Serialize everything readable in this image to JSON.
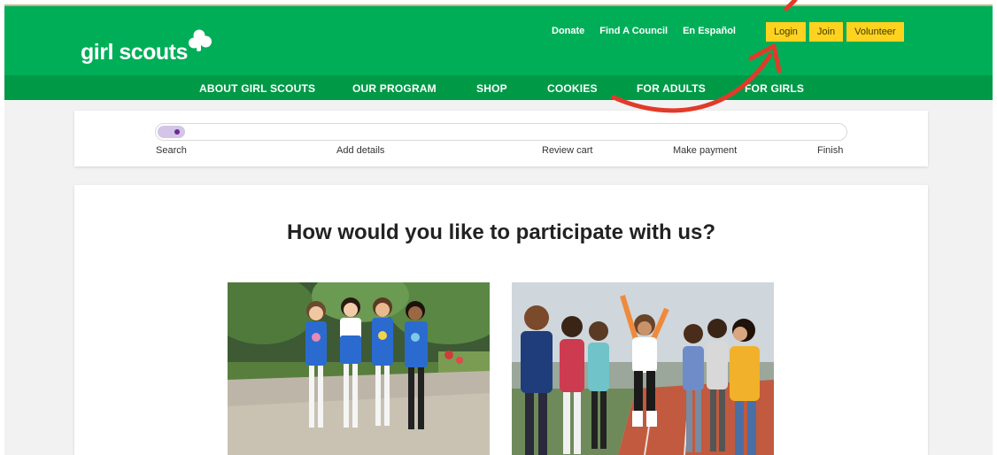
{
  "header": {
    "logo_text": "girl scouts",
    "util_links": [
      "Donate",
      "Find A Council",
      "En Español"
    ],
    "auth_buttons": [
      "Login",
      "Join",
      "Volunteer"
    ]
  },
  "nav": {
    "items": [
      "ABOUT GIRL SCOUTS",
      "OUR PROGRAM",
      "SHOP",
      "COOKIES",
      "FOR ADULTS",
      "FOR GIRLS"
    ]
  },
  "progress": {
    "fraction": 0.04,
    "steps": [
      "Search",
      "Add details",
      "Review cart",
      "Make payment",
      "Finish"
    ]
  },
  "main": {
    "title": "How would you like to participate with us?"
  },
  "colors": {
    "brand_green": "#00ae58",
    "nav_green": "#009a47",
    "button_yellow": "#ffd21f",
    "progress_purple": "#6a2c91",
    "annotation_red": "#e23a2a"
  },
  "icons": {
    "logo": "trefoil-icon",
    "annotation": "red-arrow-annotation"
  }
}
